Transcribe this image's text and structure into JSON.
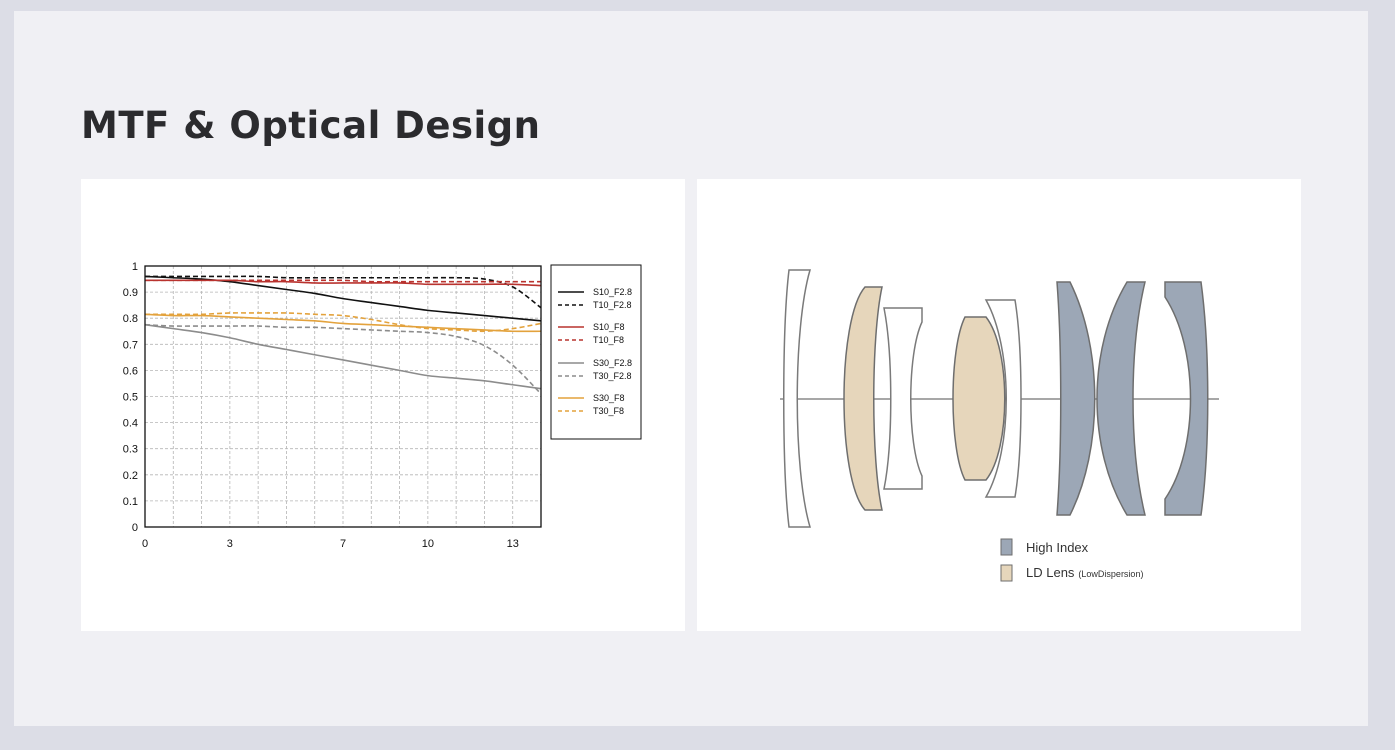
{
  "page": {
    "title": "MTF & Optical Design"
  },
  "colors": {
    "black": "#111111",
    "red": "#b9332f",
    "gray": "#8c8c8c",
    "orange": "#e3a23c",
    "high_index": "#9ca7b6",
    "ld_lens": "#e6d6bb"
  },
  "chart_data": {
    "type": "line",
    "title": "",
    "xlabel": "",
    "ylabel": "",
    "xlim": [
      0,
      14
    ],
    "ylim": [
      0,
      1
    ],
    "xticks": [
      0,
      3,
      7,
      10,
      13
    ],
    "yticks": [
      0,
      0.1,
      0.2,
      0.3,
      0.4,
      0.5,
      0.6,
      0.7,
      0.8,
      0.9,
      1
    ],
    "ytick_labels": [
      "0",
      "0.1",
      "0.2",
      "0.3",
      "0.4",
      "0.5",
      "0.6",
      "0.7",
      "0.8",
      "0.9",
      "1"
    ],
    "xtick_labels": [
      "0",
      "3",
      "7",
      "10",
      "13"
    ],
    "grid": true,
    "legend_position": "right",
    "x": [
      0,
      1,
      2,
      3,
      4,
      5,
      6,
      7,
      8,
      9,
      10,
      11,
      12,
      13,
      14
    ],
    "series": [
      {
        "name": "S10_F2.8",
        "style": "solid",
        "color": "black",
        "values": [
          0.96,
          0.955,
          0.95,
          0.94,
          0.925,
          0.91,
          0.895,
          0.875,
          0.86,
          0.845,
          0.83,
          0.82,
          0.81,
          0.8,
          0.79
        ]
      },
      {
        "name": "T10_F2.8",
        "style": "dashed",
        "color": "black",
        "values": [
          0.96,
          0.96,
          0.96,
          0.96,
          0.96,
          0.955,
          0.955,
          0.955,
          0.955,
          0.955,
          0.955,
          0.955,
          0.95,
          0.92,
          0.84
        ]
      },
      {
        "name": "S10_F8",
        "style": "solid",
        "color": "red",
        "values": [
          0.945,
          0.945,
          0.945,
          0.945,
          0.94,
          0.94,
          0.935,
          0.935,
          0.935,
          0.935,
          0.93,
          0.93,
          0.93,
          0.93,
          0.925
        ]
      },
      {
        "name": "T10_F8",
        "style": "dashed",
        "color": "red",
        "values": [
          0.945,
          0.945,
          0.945,
          0.945,
          0.945,
          0.945,
          0.945,
          0.945,
          0.94,
          0.94,
          0.94,
          0.94,
          0.94,
          0.94,
          0.94
        ]
      },
      {
        "name": "S30_F2.8",
        "style": "solid",
        "color": "gray",
        "values": [
          0.775,
          0.76,
          0.745,
          0.725,
          0.7,
          0.68,
          0.66,
          0.64,
          0.62,
          0.6,
          0.58,
          0.57,
          0.56,
          0.545,
          0.53
        ]
      },
      {
        "name": "T30_F2.8",
        "style": "dashed",
        "color": "gray",
        "values": [
          0.775,
          0.77,
          0.77,
          0.77,
          0.77,
          0.765,
          0.765,
          0.76,
          0.755,
          0.75,
          0.745,
          0.73,
          0.695,
          0.62,
          0.51
        ]
      },
      {
        "name": "S30_F8",
        "style": "solid",
        "color": "orange",
        "values": [
          0.815,
          0.81,
          0.81,
          0.805,
          0.8,
          0.795,
          0.79,
          0.78,
          0.775,
          0.77,
          0.765,
          0.76,
          0.755,
          0.75,
          0.75
        ]
      },
      {
        "name": "T30_F8",
        "style": "dashed",
        "color": "orange",
        "values": [
          0.815,
          0.815,
          0.815,
          0.82,
          0.82,
          0.82,
          0.815,
          0.81,
          0.795,
          0.775,
          0.76,
          0.755,
          0.75,
          0.76,
          0.78
        ]
      }
    ]
  },
  "optical_design": {
    "legend": [
      {
        "label": "High Index",
        "note": "",
        "color": "high_index"
      },
      {
        "label": "LD Lens",
        "note": "(LowDispersion)",
        "color": "ld_lens"
      }
    ]
  }
}
